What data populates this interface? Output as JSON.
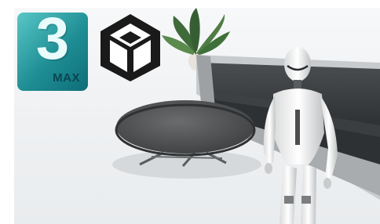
{
  "logos": {
    "max_digit": "3",
    "max_label": "MAX",
    "brand_color": "#1e8e94",
    "unity_color": "#1a1a1a"
  }
}
